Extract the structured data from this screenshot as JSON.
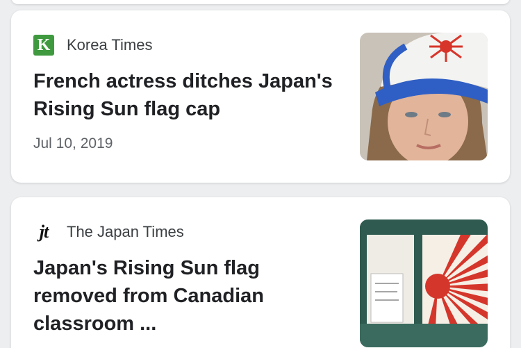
{
  "articles": [
    {
      "source": "Korea Times",
      "source_logo_text": "K",
      "headline": "French actress ditches Japan's Rising Sun flag cap",
      "date": "Jul 10, 2019",
      "logo_color": "#3f9a3f"
    },
    {
      "source": "The Japan Times",
      "source_logo_text": "jt",
      "headline": "Japan's Rising Sun flag removed from Canadian classroom ...",
      "date": ""
    }
  ]
}
